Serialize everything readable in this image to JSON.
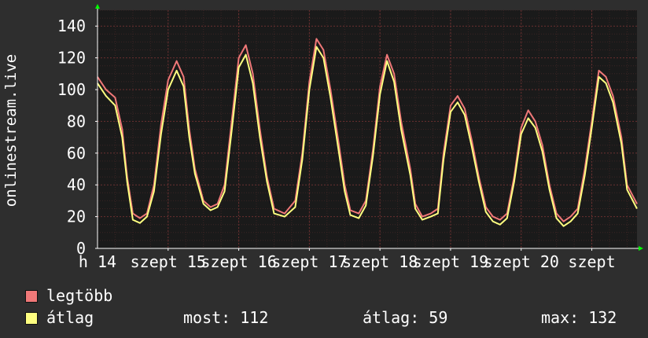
{
  "chart_data": {
    "type": "line",
    "ylabel": "onlinestream.live",
    "ylim": [
      0,
      150
    ],
    "yticks": [
      0,
      20,
      40,
      60,
      80,
      100,
      120,
      140
    ],
    "xlim": [
      0,
      7.64
    ],
    "xtick_labels": [
      "h 14",
      "szept 15",
      "szept 16",
      "szept 17",
      "szept 18",
      "szept 19",
      "szept 20",
      "szept"
    ],
    "grid": true,
    "colors": {
      "background": "#2e2e2e",
      "plot_background": "#1a1a1a",
      "grid": "#4a2626",
      "axis": "#ffffff",
      "arrow": "#00ff00"
    },
    "series": [
      {
        "name": "legtöbb",
        "color": "#f07878",
        "x": [
          0,
          0.12,
          0.25,
          0.35,
          0.42,
          0.5,
          0.6,
          0.7,
          0.8,
          0.9,
          1.0,
          1.12,
          1.22,
          1.3,
          1.38,
          1.5,
          1.6,
          1.7,
          1.8,
          1.9,
          2.0,
          2.1,
          2.2,
          2.3,
          2.4,
          2.5,
          2.65,
          2.8,
          2.9,
          3.0,
          3.1,
          3.2,
          3.3,
          3.42,
          3.5,
          3.58,
          3.7,
          3.8,
          3.9,
          4.0,
          4.1,
          4.2,
          4.3,
          4.43,
          4.5,
          4.6,
          4.72,
          4.82,
          4.9,
          5.0,
          5.1,
          5.2,
          5.3,
          5.4,
          5.5,
          5.6,
          5.7,
          5.8,
          5.9,
          6.0,
          6.1,
          6.2,
          6.3,
          6.4,
          6.5,
          6.6,
          6.7,
          6.8,
          6.9,
          7.0,
          7.1,
          7.2,
          7.3,
          7.42,
          7.5,
          7.64
        ],
        "values": [
          108,
          100,
          95,
          75,
          45,
          22,
          19,
          22,
          40,
          78,
          106,
          118,
          108,
          75,
          50,
          30,
          26,
          28,
          40,
          80,
          120,
          128,
          110,
          75,
          45,
          25,
          22,
          30,
          60,
          105,
          132,
          125,
          100,
          65,
          40,
          24,
          22,
          30,
          62,
          102,
          122,
          110,
          80,
          50,
          28,
          20,
          22,
          25,
          60,
          90,
          96,
          88,
          68,
          45,
          26,
          20,
          18,
          22,
          45,
          76,
          87,
          80,
          65,
          40,
          22,
          17,
          20,
          25,
          50,
          80,
          112,
          108,
          96,
          70,
          40,
          28
        ]
      },
      {
        "name": "átlag",
        "color": "#ffff80",
        "x": [
          0,
          0.12,
          0.25,
          0.35,
          0.42,
          0.5,
          0.6,
          0.7,
          0.8,
          0.9,
          1.0,
          1.12,
          1.22,
          1.3,
          1.38,
          1.5,
          1.6,
          1.7,
          1.8,
          1.9,
          2.0,
          2.1,
          2.2,
          2.3,
          2.4,
          2.5,
          2.65,
          2.8,
          2.9,
          3.0,
          3.1,
          3.2,
          3.3,
          3.42,
          3.5,
          3.58,
          3.7,
          3.8,
          3.9,
          4.0,
          4.1,
          4.2,
          4.3,
          4.43,
          4.5,
          4.6,
          4.72,
          4.82,
          4.9,
          5.0,
          5.1,
          5.2,
          5.3,
          5.4,
          5.5,
          5.6,
          5.7,
          5.8,
          5.9,
          6.0,
          6.1,
          6.2,
          6.3,
          6.4,
          6.5,
          6.6,
          6.7,
          6.8,
          6.9,
          7.0,
          7.1,
          7.2,
          7.3,
          7.42,
          7.5,
          7.64
        ],
        "values": [
          104,
          96,
          90,
          70,
          42,
          18,
          16,
          20,
          36,
          72,
          100,
          112,
          102,
          70,
          47,
          28,
          24,
          26,
          36,
          74,
          114,
          122,
          104,
          70,
          42,
          22,
          20,
          26,
          56,
          100,
          127,
          120,
          95,
          60,
          36,
          21,
          19,
          27,
          58,
          97,
          118,
          105,
          75,
          46,
          25,
          18,
          20,
          22,
          56,
          86,
          92,
          84,
          64,
          42,
          23,
          17,
          15,
          19,
          42,
          72,
          82,
          76,
          61,
          37,
          19,
          14,
          17,
          22,
          46,
          76,
          108,
          104,
          92,
          66,
          37,
          25
        ]
      }
    ]
  },
  "legend": {
    "max_label": "legtöbb",
    "avg_label": "átlag"
  },
  "stats": {
    "now": "most: 112",
    "avg": "átlag: 59",
    "max": "max: 132"
  }
}
